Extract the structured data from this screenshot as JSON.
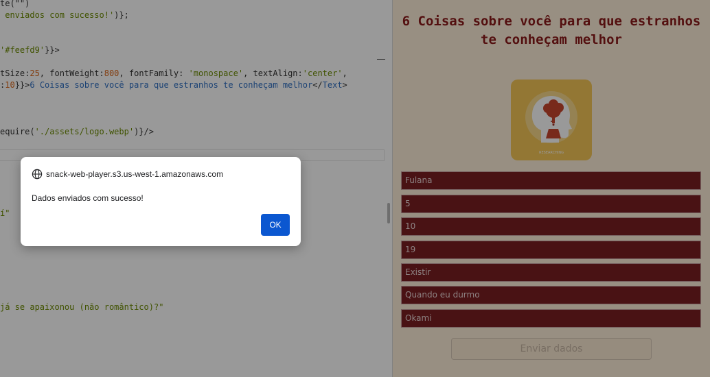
{
  "editor": {
    "lines": [
      {
        "segments": [
          {
            "t": "te(\"\")",
            "c": "plain"
          }
        ]
      },
      {
        "segments": [
          {
            "t": " enviados com sucesso!'",
            "c": "str"
          },
          {
            "t": ")};",
            "c": "plain"
          }
        ]
      },
      {
        "segments": [
          {
            "t": "'#feefd9'",
            "c": "str"
          },
          {
            "t": "}}>",
            "c": "plain"
          }
        ]
      },
      {
        "segments": [
          {
            "t": "tSize:",
            "c": "plain"
          },
          {
            "t": "25",
            "c": "num"
          },
          {
            "t": ", fontWeight:",
            "c": "plain"
          },
          {
            "t": "800",
            "c": "num"
          },
          {
            "t": ", fontFamily: ",
            "c": "plain"
          },
          {
            "t": "'monospace'",
            "c": "str"
          },
          {
            "t": ", textAlign:",
            "c": "plain"
          },
          {
            "t": "'center'",
            "c": "str"
          },
          {
            "t": ",",
            "c": "plain"
          }
        ]
      },
      {
        "segments": [
          {
            "t": ":",
            "c": "plain"
          },
          {
            "t": "10",
            "c": "num"
          },
          {
            "t": "}}>",
            "c": "plain"
          },
          {
            "t": "6 Coisas sobre você para que estranhos te conheçam melhor",
            "c": "txt"
          },
          {
            "t": "</",
            "c": "plain"
          },
          {
            "t": "Text",
            "c": "tag"
          },
          {
            "t": ">",
            "c": "plain"
          }
        ]
      },
      {
        "segments": [
          {
            "t": "equire(",
            "c": "plain"
          },
          {
            "t": "'./assets/logo.webp'",
            "c": "str"
          },
          {
            "t": ")}/>",
            "c": "plain"
          }
        ]
      },
      {
        "segments": [
          {
            "t": "í\"",
            "c": "str"
          }
        ]
      },
      {
        "segments": [
          {
            "t": "já se apaixonou (não romântico)?\"",
            "c": "str"
          }
        ]
      }
    ]
  },
  "preview": {
    "title": "6 Coisas sobre você para que estranhos te conheçam melhor",
    "logo_caption": "RESEARCHING",
    "fields": [
      "Fulana",
      "5",
      "10",
      "19",
      "Existir",
      "Quando eu durmo",
      "Okami"
    ],
    "submit_label": "Enviar dados"
  },
  "dialog": {
    "origin": "snack-web-player.s3.us-west-1.amazonaws.com",
    "message": "Dados enviados com sucesso!",
    "ok_label": "OK",
    "origin_icon": "globe-icon"
  },
  "colors": {
    "preview_bg": "#feefd9",
    "title": "#8b1a1a",
    "field_bg": "#7a1e22",
    "logo_bg": "#f5c657",
    "ok_button": "#0b57d0"
  }
}
